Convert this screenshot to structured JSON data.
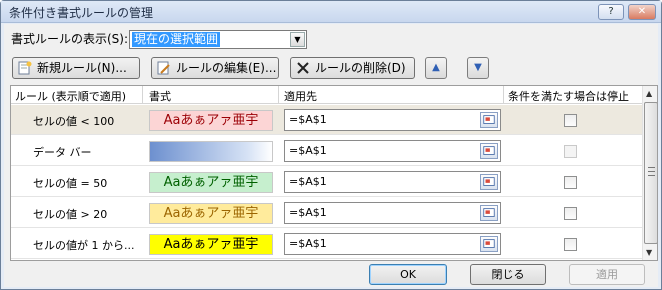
{
  "window": {
    "title": "条件付き書式ルールの管理",
    "help_label": "?",
    "close_label": "✕"
  },
  "show_rules": {
    "label": "書式ルールの表示(S):",
    "selected": "現在の選択範囲",
    "arrow": "▼"
  },
  "toolbar": {
    "new_label": "新規ルール(N)...",
    "edit_label": "ルールの編集(E)...",
    "delete_label": "ルールの削除(D)",
    "up_label": "▲",
    "down_label": "▼"
  },
  "table": {
    "headers": {
      "rule": "ルール (表示順で適用)",
      "format": "書式",
      "applies_to": "適用先",
      "stop_if_true": "条件を満たす場合は停止"
    },
    "rows": [
      {
        "rule": "セルの値 < 100",
        "preview": "Aaあぁアァ亜宇",
        "fill": "#fcd5d5",
        "font_color": "#9c0006",
        "applies_to": "=$A$1",
        "stop": false,
        "selected": true
      },
      {
        "rule": "データ バー",
        "preview": "",
        "fill": "databar",
        "font_color": "#000000",
        "applies_to": "=$A$1",
        "stop": false,
        "selected": false
      },
      {
        "rule": "セルの値 = 50",
        "preview": "Aaあぁアァ亜宇",
        "fill": "#c6efce",
        "font_color": "#006100",
        "applies_to": "=$A$1",
        "stop": false,
        "selected": false
      },
      {
        "rule": "セルの値 > 20",
        "preview": "Aaあぁアァ亜宇",
        "fill": "#ffeb9c",
        "font_color": "#9c6500",
        "applies_to": "=$A$1",
        "stop": false,
        "selected": false
      },
      {
        "rule": "セルの値が 1 から...",
        "preview": "Aaあぁアァ亜宇",
        "fill": "#ffff00",
        "font_color": "#000000",
        "applies_to": "=$A$1",
        "stop": false,
        "selected": false
      }
    ]
  },
  "buttons": {
    "ok": "OK",
    "close": "閉じる",
    "apply": "適用"
  },
  "colors": {
    "accent": "#3399ff",
    "selected_row": "#ede9df"
  }
}
